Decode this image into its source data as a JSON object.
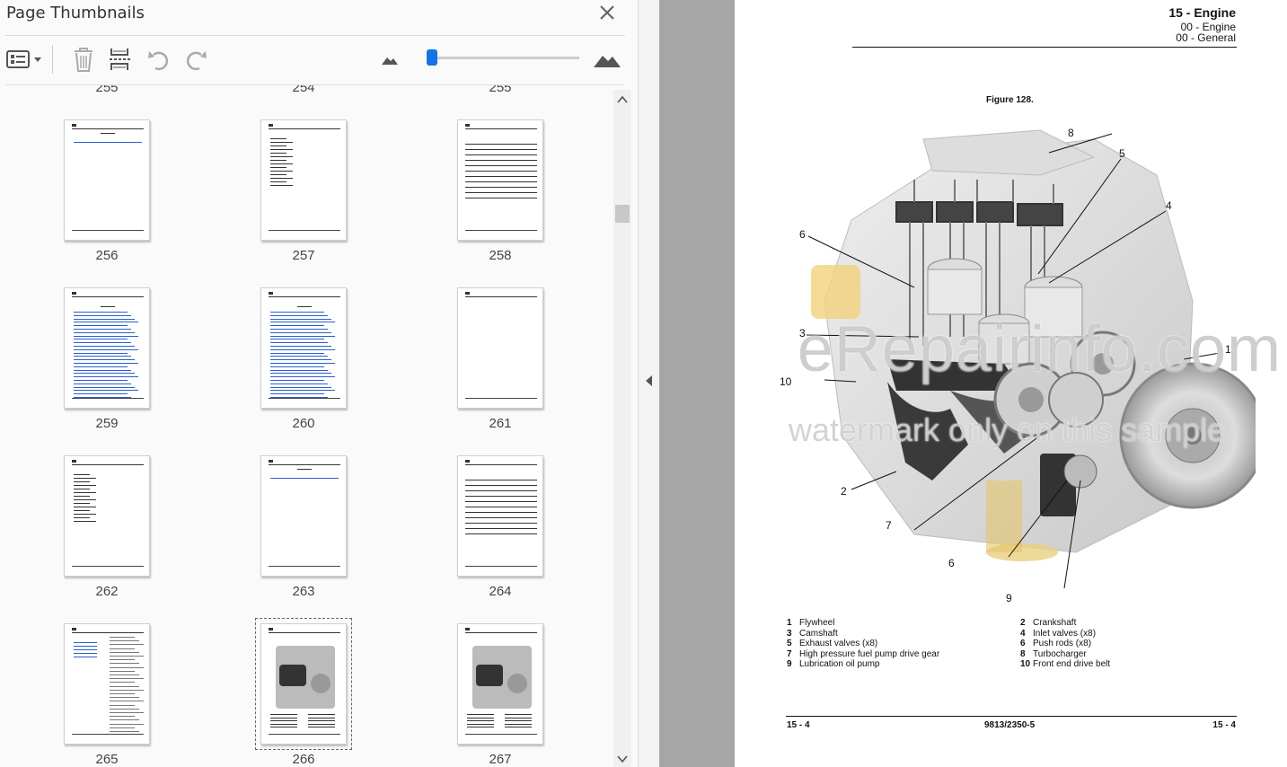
{
  "panel": {
    "title": "Page Thumbnails",
    "partial_labels": [
      "255",
      "254",
      "255"
    ],
    "thumbnails": [
      {
        "label": "256",
        "kind": "toc-short"
      },
      {
        "label": "257",
        "kind": "list"
      },
      {
        "label": "258",
        "kind": "lines"
      },
      {
        "label": "259",
        "kind": "toc-long"
      },
      {
        "label": "260",
        "kind": "toc-blue"
      },
      {
        "label": "261",
        "kind": "blank"
      },
      {
        "label": "262",
        "kind": "list"
      },
      {
        "label": "263",
        "kind": "toc-short"
      },
      {
        "label": "264",
        "kind": "lines"
      },
      {
        "label": "265",
        "kind": "text"
      },
      {
        "label": "266",
        "kind": "figure",
        "selected": true
      },
      {
        "label": "267",
        "kind": "figure"
      }
    ]
  },
  "toolbar": {
    "options_icon": "thumbnail-options-icon",
    "delete_icon": "trash-icon",
    "insert_icon": "insert-pages-icon",
    "rotate_left_icon": "rotate-counterclockwise-icon",
    "rotate_right_icon": "rotate-clockwise-icon",
    "zoom_slider_value": 0.03
  },
  "document": {
    "header_title": "15 - Engine",
    "header_sub1": "00 - Engine",
    "header_sub2": "00 - General",
    "figure_title": "Figure 128.",
    "watermark_line1": "eRepairinfo.com",
    "watermark_line2": "watermark only on this sample",
    "callouts": [
      "1",
      "2",
      "3",
      "4",
      "5",
      "6",
      "6",
      "7",
      "8",
      "9",
      "10"
    ],
    "legend": [
      {
        "n": "1",
        "text": "Flywheel"
      },
      {
        "n": "2",
        "text": "Crankshaft"
      },
      {
        "n": "3",
        "text": "Camshaft"
      },
      {
        "n": "4",
        "text": "Inlet valves (x8)"
      },
      {
        "n": "5",
        "text": "Exhaust valves (x8)"
      },
      {
        "n": "6",
        "text": "Push rods (x8)"
      },
      {
        "n": "7",
        "text": "High pressure fuel pump drive gear"
      },
      {
        "n": "8",
        "text": "Turbocharger"
      },
      {
        "n": "9",
        "text": "Lubrication oil pump"
      },
      {
        "n": "10",
        "text": "Front end drive belt"
      }
    ],
    "footer_left": "15 - 4",
    "footer_mid": "9813/2350-5",
    "footer_right": "15 - 4"
  },
  "colors": {
    "accent": "#1473e6",
    "doc_background": "#a6a6a6"
  }
}
